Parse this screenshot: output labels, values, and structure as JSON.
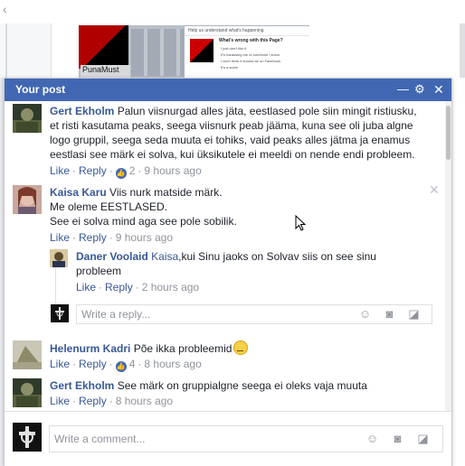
{
  "background": {
    "page_label": "PunaMust",
    "dialog_title": "Help us understand what's happening",
    "dialog_question": "What's wrong with this Page?",
    "dialog_options": [
      "I just don't like it",
      "It's harassing me or someone I know",
      "I don't think it should be on Facebook",
      "It's a scam"
    ]
  },
  "window": {
    "title": "Your post",
    "minimize_glyph": "—",
    "settings_glyph": "⚙",
    "close_glyph": "✕"
  },
  "comments": [
    {
      "author": "Gert Ekholm",
      "lines": [
        "Palun viisnurgad alles jäta, eestlased pole siin mingit ristiusku,",
        "et risti kasutama peaks, seega viisnurk peab jääma, kuna see oli juba algne",
        "logo gruppil, seega seda muuta ei tohiks, vaid peaks alles jätma ja enamus",
        "eestlasi see märk ei solva, kui üksikutele ei meeldi on nende endi probleem."
      ],
      "like": "Like",
      "reply": "Reply",
      "likes": "2",
      "time": "9 hours ago"
    },
    {
      "author": "Kaisa Karu",
      "lines": [
        "Viis nurk matside märk.",
        "Me oleme EESTLASED.",
        "See ei solva mind aga see pole sobilik."
      ],
      "like": "Like",
      "reply": "Reply",
      "time": "9 hours ago"
    },
    {
      "author": "Daner Voolaid",
      "mention": "Kaisa",
      "lines": [
        ",kui Sinu jaoks on Solvav siis on see sinu",
        "probleem"
      ],
      "like": "Like",
      "reply": "Reply",
      "time": "2 hours ago"
    },
    {
      "author": "Helenurm Kadri",
      "lines": [
        "Põe ikka probleemid"
      ],
      "like": "Like",
      "reply": "Reply",
      "likes": "4",
      "time": "8 hours ago"
    },
    {
      "author": "Gert Ekholm",
      "lines": [
        "See märk on gruppialgne seega ei oleks vaja muuta"
      ],
      "like": "Like",
      "reply": "Reply",
      "time": "8 hours ago"
    }
  ],
  "reply_input": {
    "placeholder": "Write a reply..."
  },
  "comment_input": {
    "placeholder": "Write a comment..."
  },
  "icons": [
    "emoji-icon",
    "camera-icon",
    "sticker-icon",
    "thumbs-up-icon",
    "close-icon",
    "settings-icon",
    "minimize-icon"
  ],
  "colors": {
    "header": "#4267b2",
    "link": "#385898",
    "meta": "#90949c"
  }
}
